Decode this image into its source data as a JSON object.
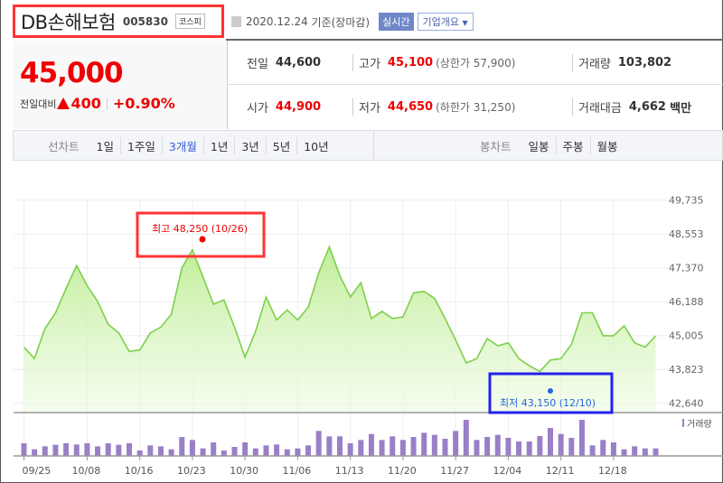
{
  "header": {
    "name": "DB손해보험",
    "code": "005830",
    "market": "코스피",
    "date": "2020.12.24",
    "basis": "기준(장마감)",
    "realtime_label": "실시간",
    "company_label": "기업개요"
  },
  "quote": {
    "price": "45,000",
    "change_label": "전일대비",
    "change": "400",
    "change_pct": "+0.90%",
    "prev_label": "전일",
    "prev": "44,600",
    "high_label": "고가",
    "high": "45,100",
    "upper_limit": "(상한가 57,900)",
    "volume_label": "거래량",
    "volume": "103,802",
    "open_label": "시가",
    "open": "44,900",
    "low_label": "저가",
    "low": "44,650",
    "lower_limit": "(하한가 31,250)",
    "amount_label": "거래대금",
    "amount": "4,662",
    "amount_unit": "백만"
  },
  "tabs": {
    "line_label": "선차트",
    "line": [
      "1일",
      "1주일",
      "3개월",
      "1년",
      "3년",
      "5년",
      "10년"
    ],
    "active": "3개월",
    "candle_label": "봉차트",
    "candle": [
      "일봉",
      "주봉",
      "월봉"
    ]
  },
  "colors": {
    "up": "#ee0000",
    "line": "#7ed04b",
    "volume": "#9a7fc8",
    "max": "#ee0000",
    "min": "#2266dd"
  },
  "chart_data": {
    "type": "area",
    "yticks": [
      "49,735",
      "48,553",
      "47,370",
      "46,188",
      "45,005",
      "43,823",
      "42,640"
    ],
    "ylim": [
      42640,
      49735
    ],
    "xtick_labels": [
      "09/25",
      "10/08",
      "10/16",
      "10/23",
      "10/30",
      "11/06",
      "11/13",
      "11/20",
      "11/27",
      "12/04",
      "12/11",
      "12/18"
    ],
    "xtick_index": [
      0,
      6,
      11,
      16,
      21,
      26,
      31,
      36,
      41,
      46,
      51,
      56
    ],
    "close": [
      44600,
      44200,
      45250,
      45800,
      46650,
      47450,
      46750,
      46200,
      45400,
      45100,
      44450,
      44500,
      45100,
      45300,
      45750,
      47370,
      48000,
      47050,
      46100,
      46250,
      45300,
      44250,
      45150,
      46350,
      45550,
      45900,
      45550,
      46000,
      47200,
      48100,
      47100,
      46350,
      46850,
      45600,
      45850,
      45600,
      45650,
      46500,
      46550,
      46300,
      45600,
      44850,
      44050,
      44200,
      44900,
      44650,
      44750,
      44200,
      43950,
      43750,
      44150,
      44200,
      44700,
      45800,
      45800,
      45000,
      45000,
      45350,
      44750,
      44600,
      45000
    ],
    "volume_relative": [
      42,
      22,
      32,
      37,
      42,
      38,
      42,
      32,
      42,
      37,
      42,
      18,
      35,
      32,
      22,
      63,
      53,
      25,
      45,
      18,
      30,
      45,
      25,
      35,
      38,
      22,
      25,
      35,
      83,
      65,
      65,
      42,
      53,
      73,
      53,
      65,
      53,
      63,
      77,
      70,
      57,
      83,
      120,
      53,
      63,
      70,
      60,
      48,
      48,
      66,
      93,
      73,
      60,
      120,
      35,
      53,
      45,
      22,
      32,
      25,
      25
    ],
    "volume_label": "거래량",
    "max_label": "최고",
    "max_value": "48,250",
    "max_date": "(10/26)",
    "min_label": "최저",
    "min_value": "43,150",
    "min_date": "(12/10)"
  }
}
